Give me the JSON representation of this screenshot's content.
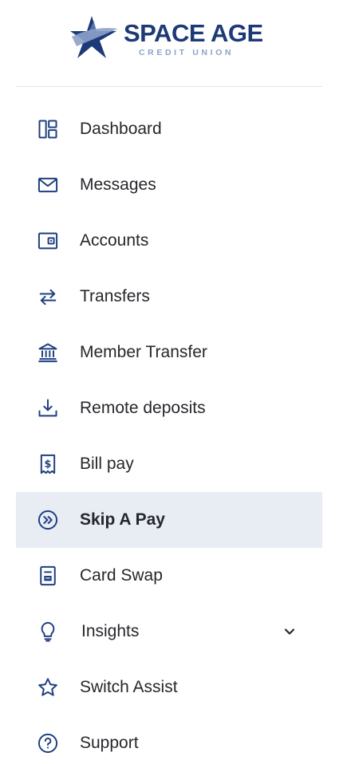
{
  "brand": {
    "name": "SPACE AGE",
    "subtitle": "CREDIT UNION",
    "colors": {
      "primary": "#1d3a78",
      "secondary": "#8da2c9"
    }
  },
  "colors": {
    "icon": "#1f3f82",
    "text": "#25272b",
    "active_background": "#e8edf4",
    "divider": "#e2e4e8"
  },
  "nav": {
    "items": [
      {
        "label": "Dashboard",
        "icon": "dashboard-icon"
      },
      {
        "label": "Messages",
        "icon": "envelope-icon"
      },
      {
        "label": "Accounts",
        "icon": "wallet-icon"
      },
      {
        "label": "Transfers",
        "icon": "transfer-arrows-icon"
      },
      {
        "label": "Member Transfer",
        "icon": "bank-icon"
      },
      {
        "label": "Remote deposits",
        "icon": "download-tray-icon"
      },
      {
        "label": "Bill pay",
        "icon": "dollar-receipt-icon"
      },
      {
        "label": "Skip A Pay",
        "icon": "fast-forward-circle-icon",
        "active": true
      },
      {
        "label": "Card Swap",
        "icon": "card-swap-icon"
      },
      {
        "label": "Insights",
        "icon": "lightbulb-icon",
        "expandable": true,
        "expand_icon": "chevron-down-icon"
      },
      {
        "label": "Switch Assist",
        "icon": "star-icon"
      },
      {
        "label": "Support",
        "icon": "help-circle-icon"
      }
    ]
  }
}
